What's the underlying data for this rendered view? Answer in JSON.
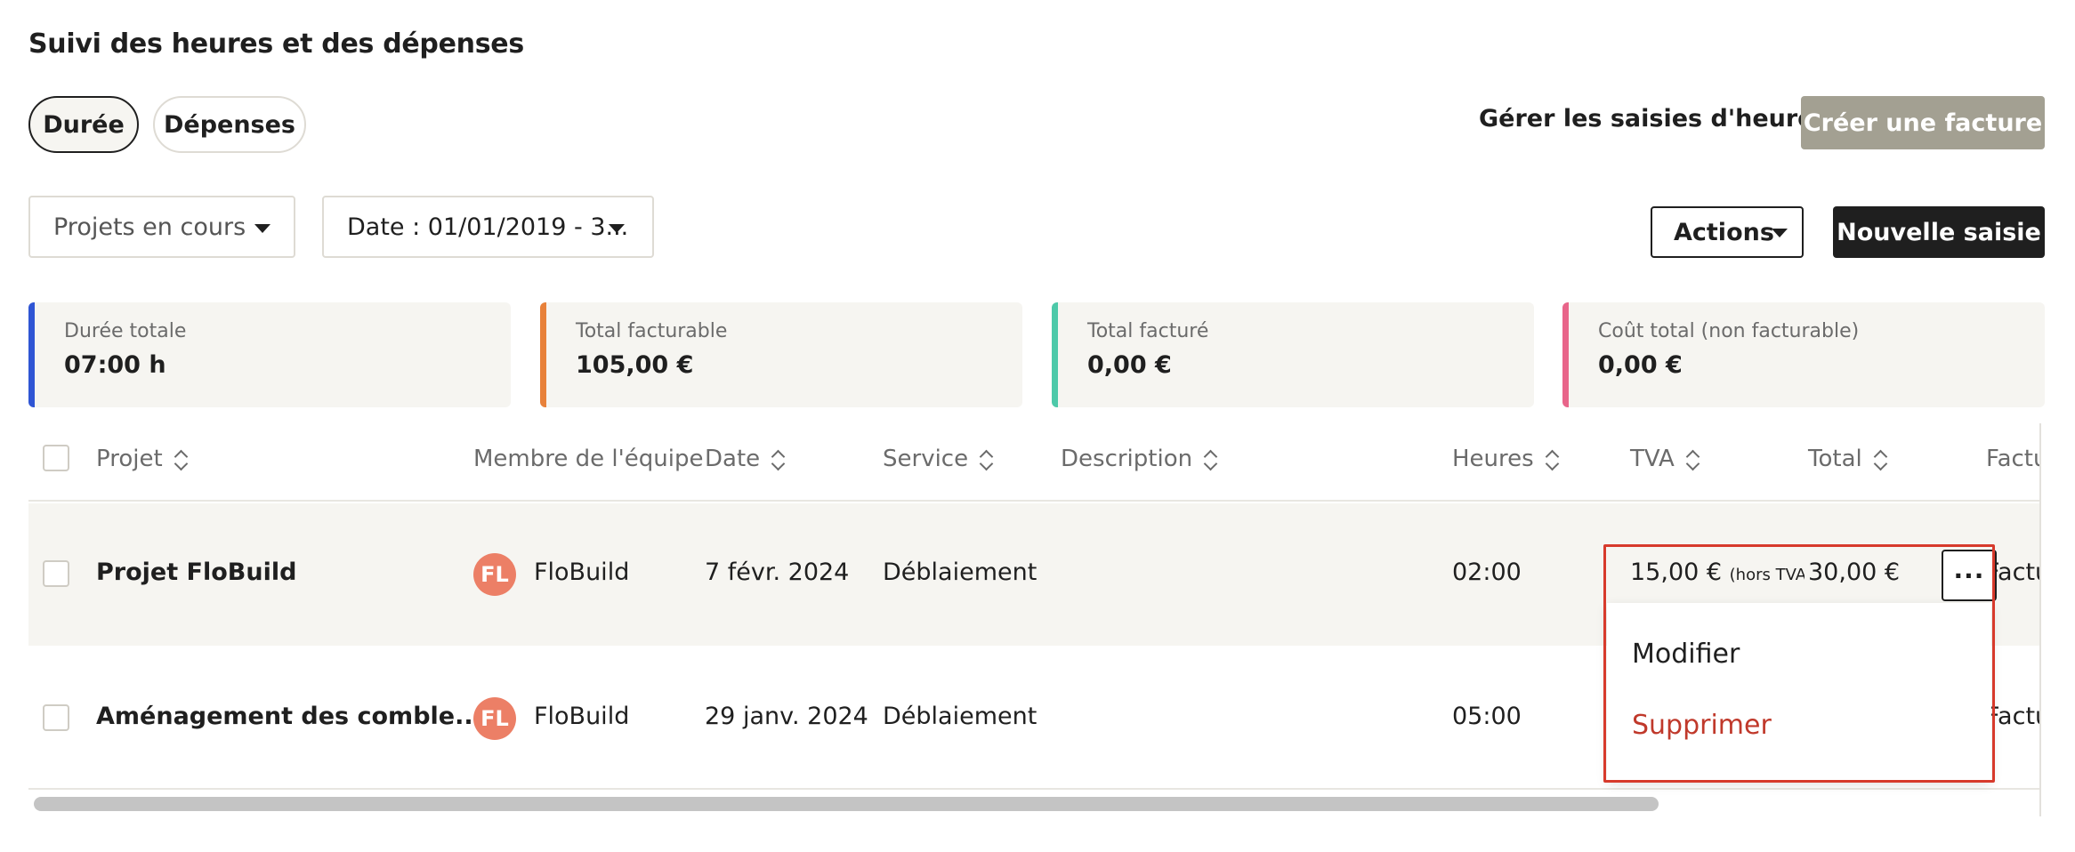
{
  "page": {
    "title": "Suivi des heures et des dépenses"
  },
  "tabs": [
    {
      "label": "Durée",
      "active": true
    },
    {
      "label": "Dépenses",
      "active": false
    }
  ],
  "header_actions": {
    "manage_label": "Gérer les saisies d'heure",
    "invoice_label": "Créer une facture"
  },
  "filters": {
    "projects_label": "Projets en cours",
    "date_label": "Date : 01/01/2019 - 3..."
  },
  "toolbar": {
    "actions_label": "Actions",
    "new_entry_label": "Nouvelle saisie"
  },
  "stats": [
    {
      "label": "Durée totale",
      "value": "07:00 h",
      "color": "#2f55d4"
    },
    {
      "label": "Total facturable",
      "value": "105,00 €",
      "color": "#e8813a"
    },
    {
      "label": "Total facturé",
      "value": "0,00 €",
      "color": "#4dc9a9"
    },
    {
      "label": "Coût total (non facturable)",
      "value": "0,00 €",
      "color": "#e8658a"
    }
  ],
  "table": {
    "columns": [
      "Projet",
      "Membre de l'équipe",
      "Date",
      "Service",
      "Description",
      "Heures",
      "TVA",
      "Total",
      "Factu"
    ],
    "rows": [
      {
        "project": "Projet FloBuild",
        "member_initials": "FL",
        "member": "FloBuild",
        "date": "7 févr. 2024",
        "service": "Déblaiement",
        "hours": "02:00",
        "tva": "15,00 €",
        "tva_suffix": "(hors TVA",
        "total": "30,00 €",
        "invoice": "Factu"
      },
      {
        "project": "Aménagement des comble...",
        "member_initials": "FL",
        "member": "FloBuild",
        "date": "29 janv. 2024",
        "service": "Déblaiement",
        "hours": "05:00",
        "invoice": "Factu"
      }
    ]
  },
  "row_menu": {
    "more_label": "···",
    "edit_label": "Modifier",
    "delete_label": "Supprimer"
  }
}
